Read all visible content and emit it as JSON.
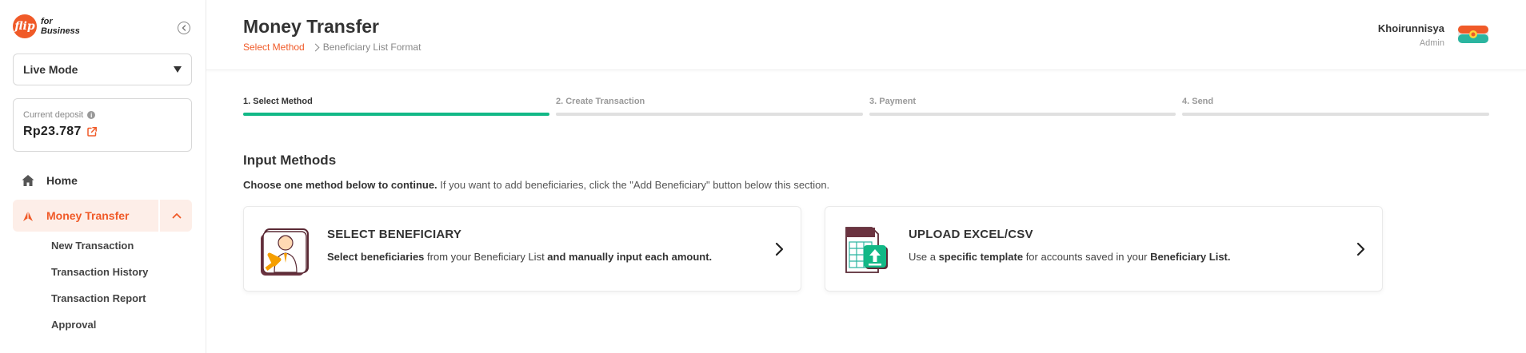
{
  "brand": {
    "logo_mark": "flip",
    "logo_line1": "for",
    "logo_line2": "Business",
    "accent": "#f05a28",
    "success": "#12b886"
  },
  "sidebar": {
    "mode": "Live Mode",
    "deposit": {
      "label": "Current deposit",
      "amount": "Rp23.787"
    },
    "nav": {
      "home": "Home",
      "money_transfer": "Money Transfer"
    },
    "sub_items": [
      "New Transaction",
      "Transaction History",
      "Transaction Report",
      "Approval"
    ]
  },
  "header": {
    "title": "Money Transfer",
    "breadcrumb": [
      "Select Method",
      "Beneficiary List Format"
    ],
    "user": {
      "name": "Khoirunnisya",
      "role": "Admin"
    }
  },
  "stepper": {
    "steps": [
      "1. Select Method",
      "2. Create Transaction",
      "3. Payment",
      "4. Send"
    ],
    "active_index": 0
  },
  "content": {
    "section_title": "Input Methods",
    "desc_bold": "Choose one method below to continue.",
    "desc_rest": " If you want to add beneficiaries, click the \"Add Beneficiary\" button below this section.",
    "cards": [
      {
        "title": "SELECT BENEFICIARY",
        "desc_b1": "Select beneficiaries",
        "desc_t1": " from your Beneficiary List ",
        "desc_b2": "and manually input each amount.",
        "icon": "person-select-icon"
      },
      {
        "title": "UPLOAD EXCEL/CSV",
        "desc_t0": "Use a ",
        "desc_b1": "specific template",
        "desc_t1": " for accounts saved in your ",
        "desc_b2": "Beneficiary List.",
        "icon": "spreadsheet-upload-icon"
      }
    ]
  }
}
